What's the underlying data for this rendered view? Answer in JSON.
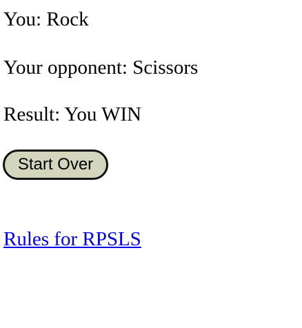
{
  "game": {
    "you_label": "You:",
    "you_choice": "Rock",
    "opponent_label": "Your opponent:",
    "opponent_choice": "Scissors",
    "result_label": "Result:",
    "result_value": "You WIN"
  },
  "controls": {
    "start_over_label": "Start Over"
  },
  "links": {
    "rules_label": "Rules for RPSLS"
  },
  "colors": {
    "button_background": "#d3d6bd",
    "link": "#0000ee"
  }
}
